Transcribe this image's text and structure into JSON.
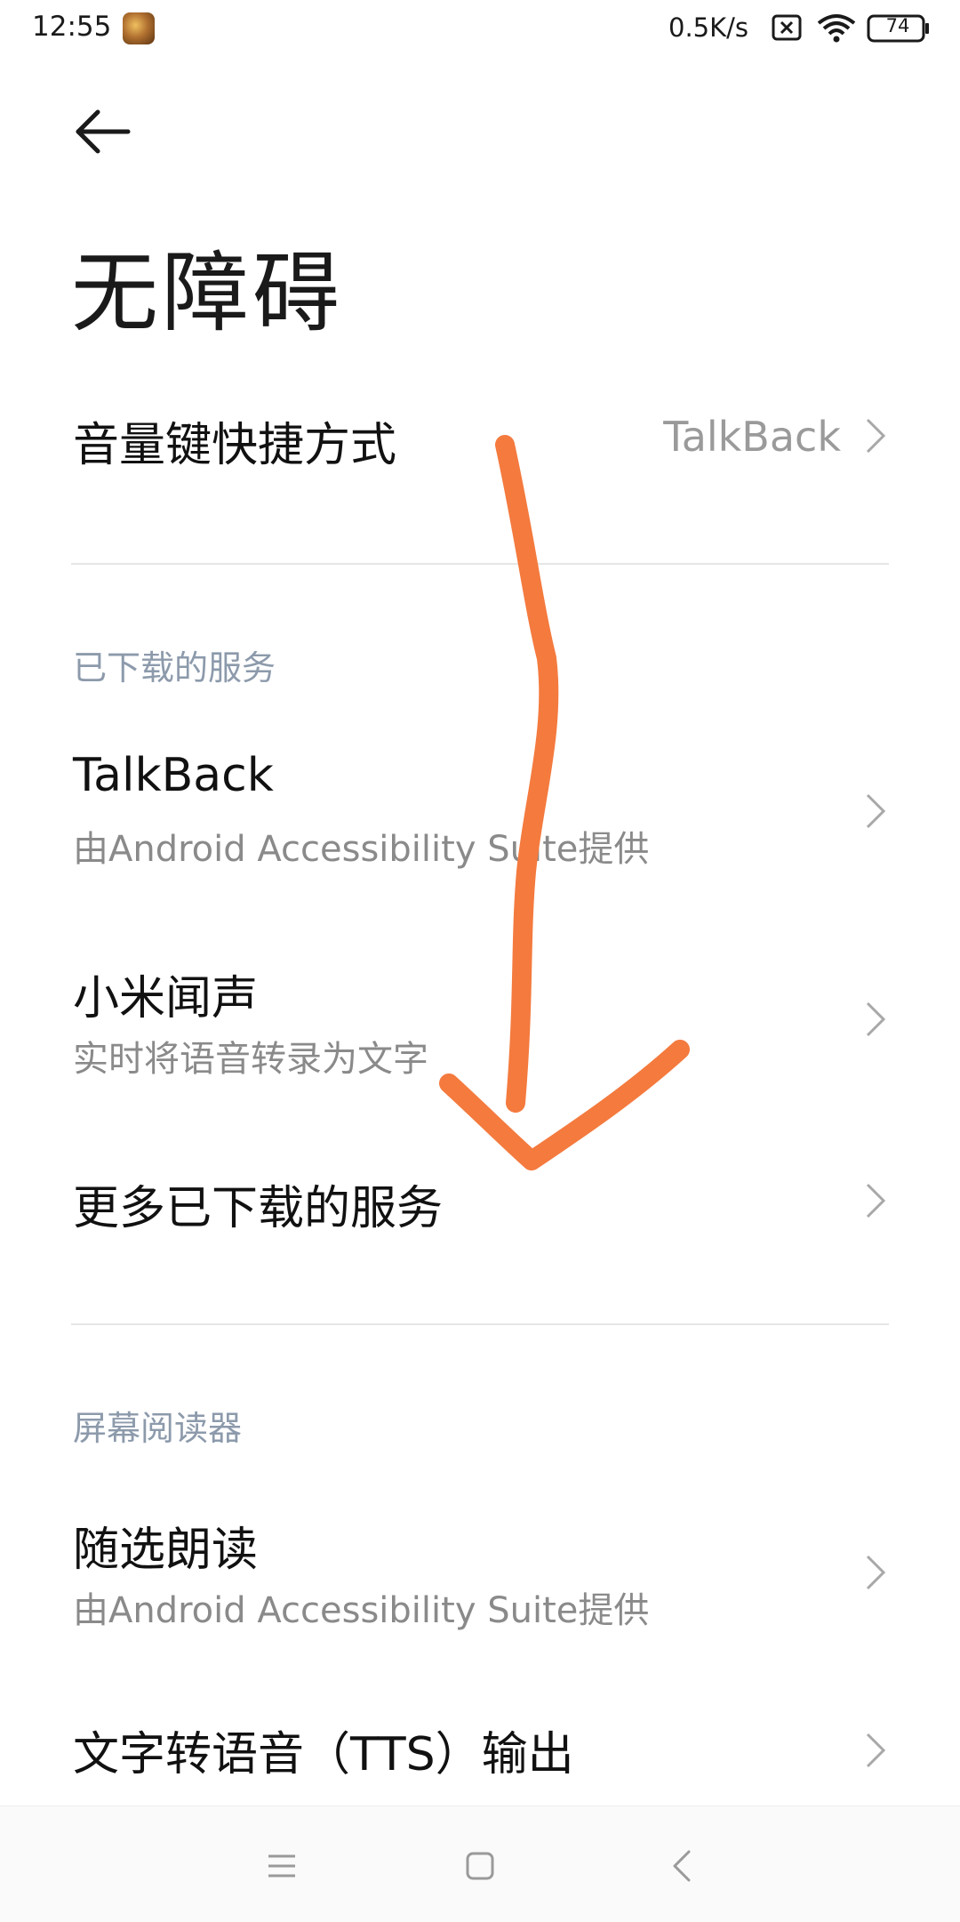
{
  "status_bar": {
    "time": "12:55",
    "network_speed": "0.5K/s",
    "battery_level": "74"
  },
  "header": {
    "title": "无障碍"
  },
  "volume_shortcut": {
    "label": "音量键快捷方式",
    "value": "TalkBack"
  },
  "downloaded_services": {
    "header": "已下载的服务",
    "items": [
      {
        "title": "TalkBack",
        "subtitle": "由Android Accessibility Suite提供"
      },
      {
        "title": "小米闻声",
        "subtitle": "实时将语音转录为文字"
      }
    ],
    "more_label": "更多已下载的服务"
  },
  "screen_reader": {
    "header": "屏幕阅读器",
    "items": [
      {
        "title": "随选朗读",
        "subtitle": "由Android Accessibility Suite提供"
      },
      {
        "title": "文字转语音（TTS）输出"
      }
    ]
  },
  "icons": {
    "back": "arrow-left-icon",
    "chevron": "chevron-right-icon",
    "nav_menu": "menu-icon",
    "nav_home": "home-square-icon",
    "nav_back": "nav-back-icon"
  },
  "colors": {
    "section_header": "#8c9aab",
    "annotation_stroke": "#f47a3e",
    "secondary_text": "#8a8a8a"
  }
}
